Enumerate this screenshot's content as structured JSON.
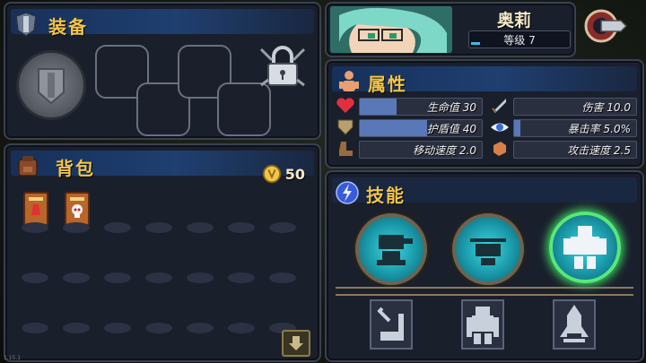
{
  "equipment": {
    "title": "装备"
  },
  "backpack": {
    "title": "背包",
    "coins": "50"
  },
  "character": {
    "name": "奥莉",
    "level_label": "等级 7"
  },
  "attributes": {
    "title": "属性",
    "stats": [
      {
        "label": "生命值 30",
        "icon": "heart-icon"
      },
      {
        "label": "伤害 10.0",
        "icon": "sword-icon"
      },
      {
        "label": "护盾值 40",
        "icon": "shield-icon"
      },
      {
        "label": "暴击率 5.0%",
        "icon": "eye-icon"
      },
      {
        "label": "移动速度 2.0",
        "icon": "boot-icon"
      },
      {
        "label": "攻击速度 2.5",
        "icon": "fist-icon"
      }
    ]
  },
  "skills": {
    "title": "技能"
  },
  "version": "1.15.1",
  "colors": {
    "accent": "#f2c54a",
    "panel": "#1a1f2c",
    "header": "#1f3f70",
    "skill_selected": "#58e87a"
  }
}
